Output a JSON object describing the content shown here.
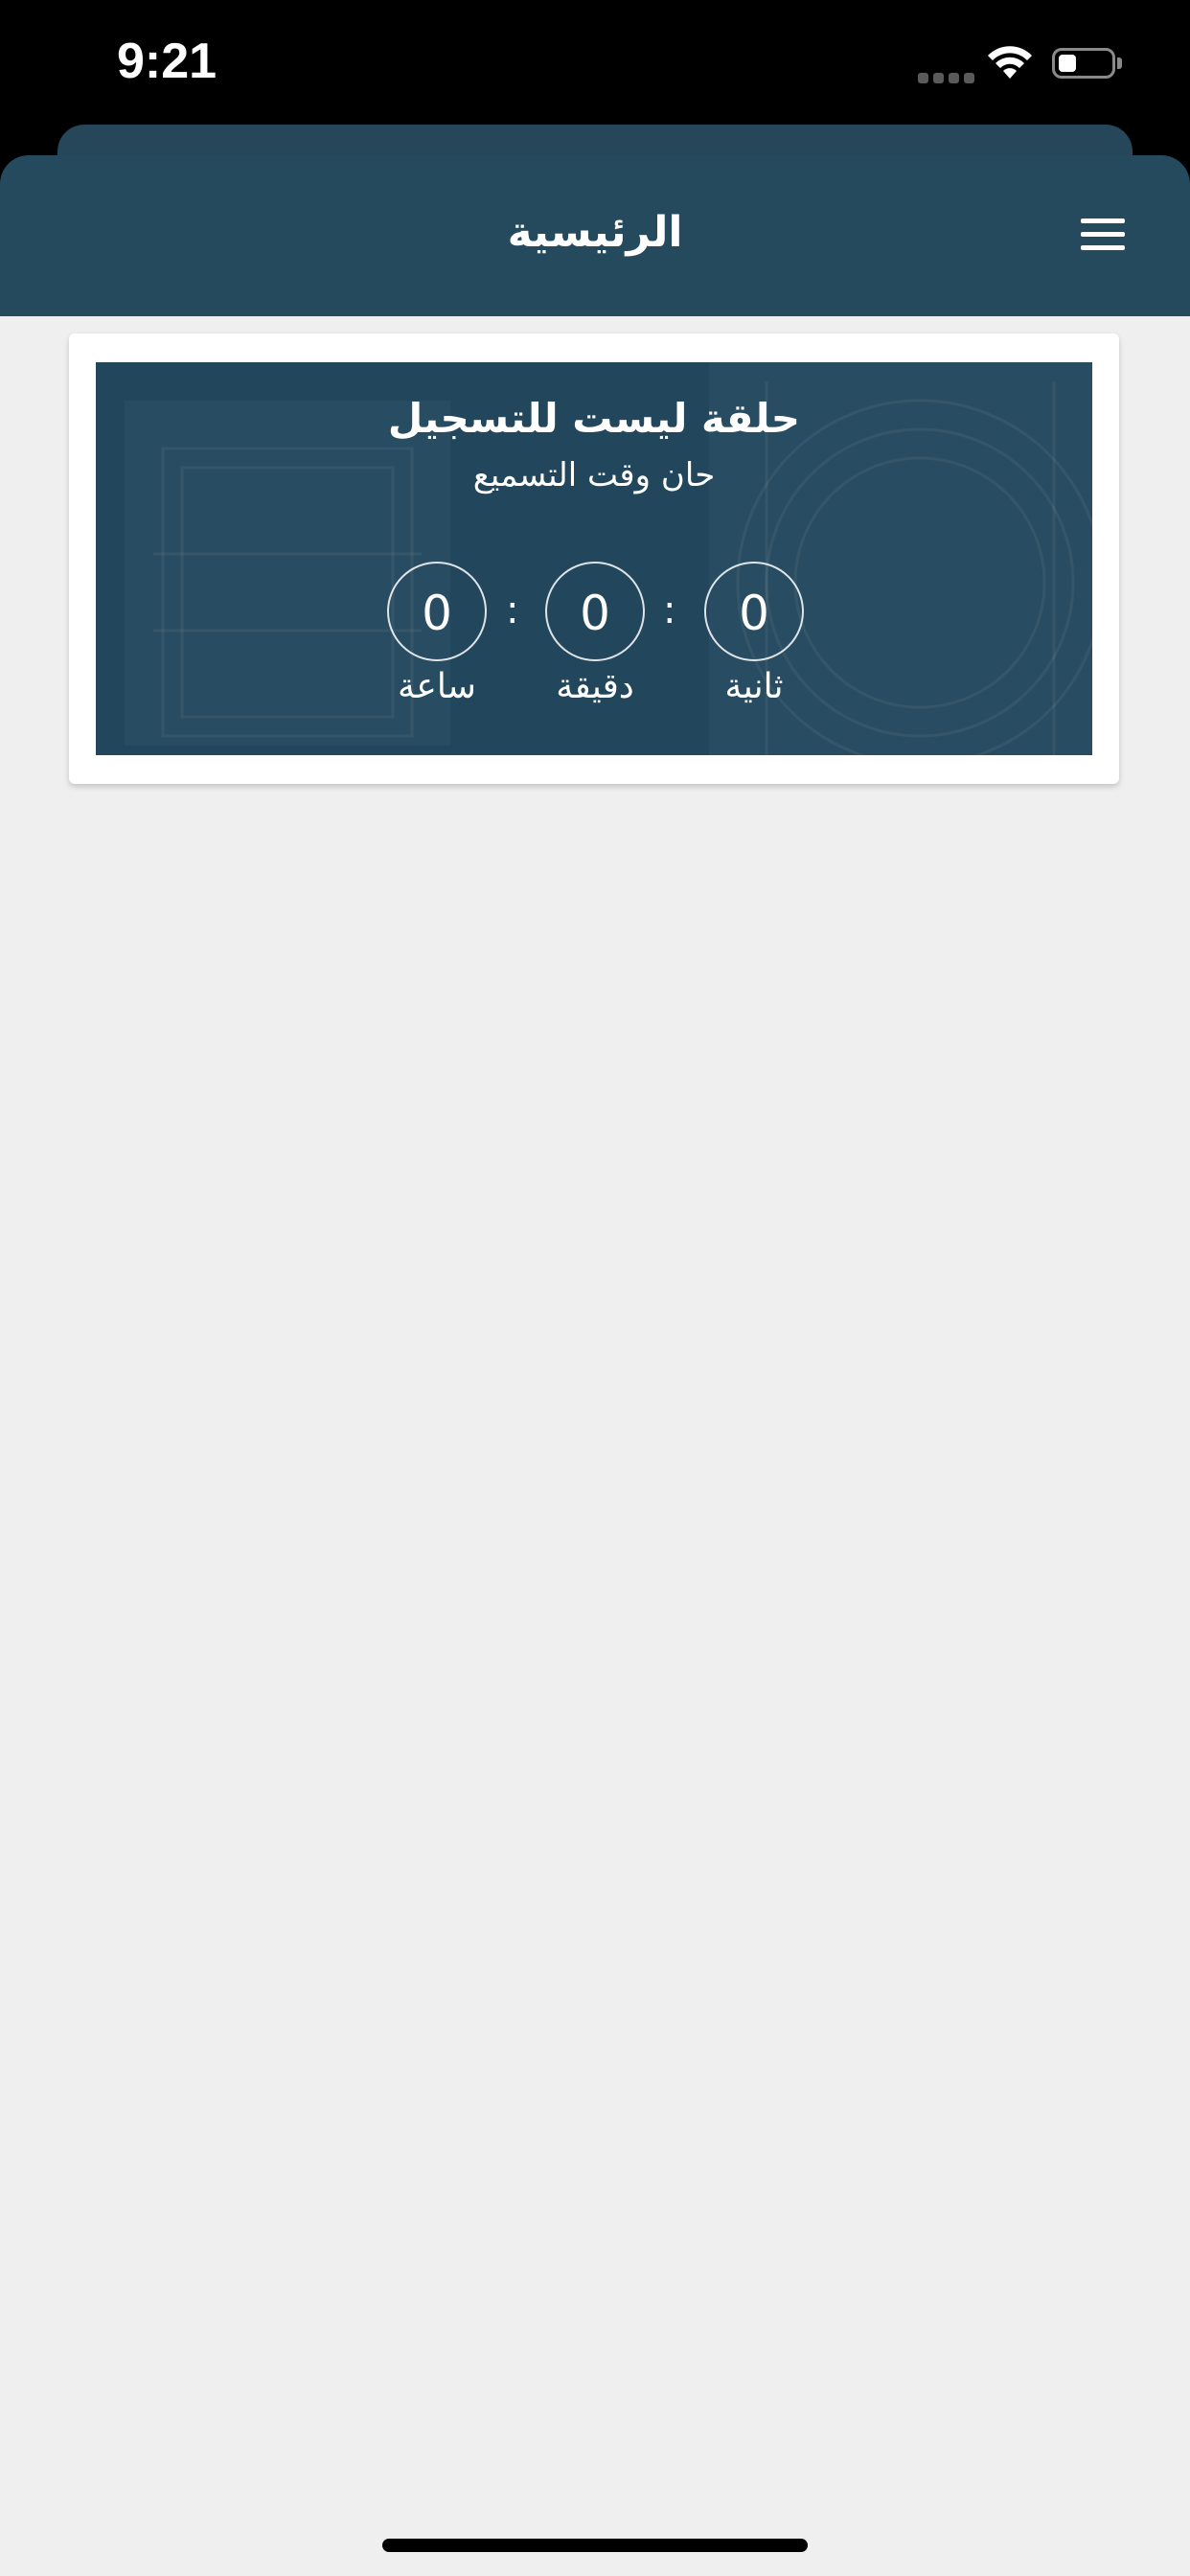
{
  "status_bar": {
    "time": "9:21"
  },
  "header": {
    "title": "الرئيسية",
    "menu_icon": "hamburger-menu-icon"
  },
  "banner": {
    "title": "حلقة ليست للتسجيل",
    "subtitle": "حان وقت التسميع",
    "separator": ":",
    "countdown": {
      "seconds": {
        "value": "0",
        "label": "ثانية"
      },
      "minutes": {
        "value": "0",
        "label": "دقيقة"
      },
      "hours": {
        "value": "0",
        "label": "ساعة"
      }
    }
  },
  "colors": {
    "header": "#254a5e",
    "banner": "#22475c",
    "background": "#efefef"
  }
}
